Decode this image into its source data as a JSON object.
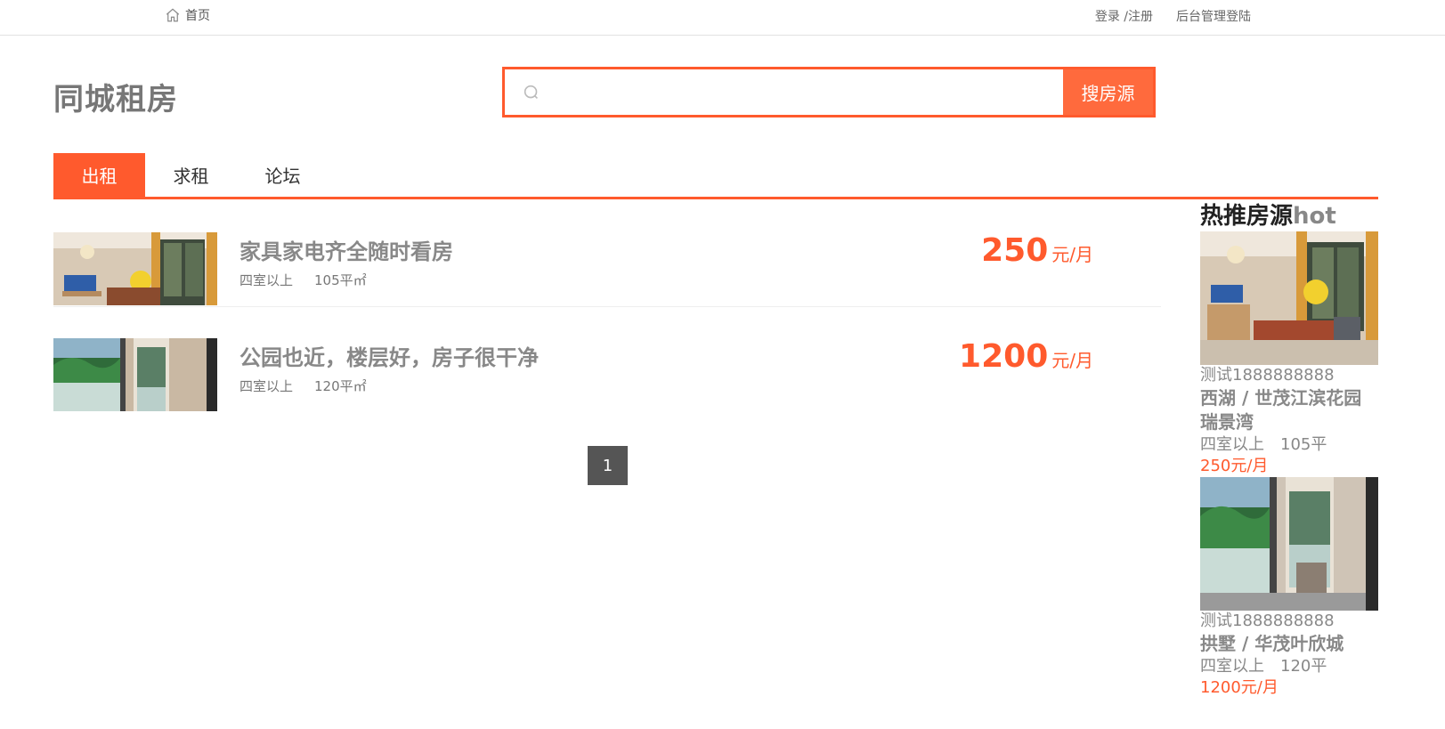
{
  "topbar": {
    "home_label": "首页",
    "login_label": "登录 /注册",
    "admin_label": "后台管理登陆"
  },
  "header": {
    "logo": "同城租房",
    "search_placeholder": "",
    "search_button": "搜房源"
  },
  "tabs": [
    {
      "label": "出租",
      "active": true
    },
    {
      "label": "求租",
      "active": false
    },
    {
      "label": "论坛",
      "active": false
    }
  ],
  "listings": [
    {
      "title": "家具家电齐全随时看房",
      "rooms": "四室以上",
      "area": "105平㎡",
      "price": "250",
      "unit": "元/月"
    },
    {
      "title": "公园也近，楼层好，房子很干净",
      "rooms": "四室以上",
      "area": "120平㎡",
      "price": "1200",
      "unit": "元/月"
    }
  ],
  "pagination": {
    "current_page": "1"
  },
  "sidebar": {
    "title": "热推房源",
    "title_hot": "hot",
    "items": [
      {
        "contact": "测试1888888888",
        "name": "西湖 / 世茂江滨花园瑞景湾",
        "rooms": "四室以上",
        "area": "105平",
        "price": "250元/月"
      },
      {
        "contact": "测试1888888888",
        "name": "拱墅 / 华茂叶欣城",
        "rooms": "四室以上",
        "area": "120平",
        "price": "1200元/月"
      }
    ]
  },
  "colors": {
    "accent": "#ff5a2d",
    "search_button": "#ff6a3d",
    "pagination": "#555555"
  }
}
